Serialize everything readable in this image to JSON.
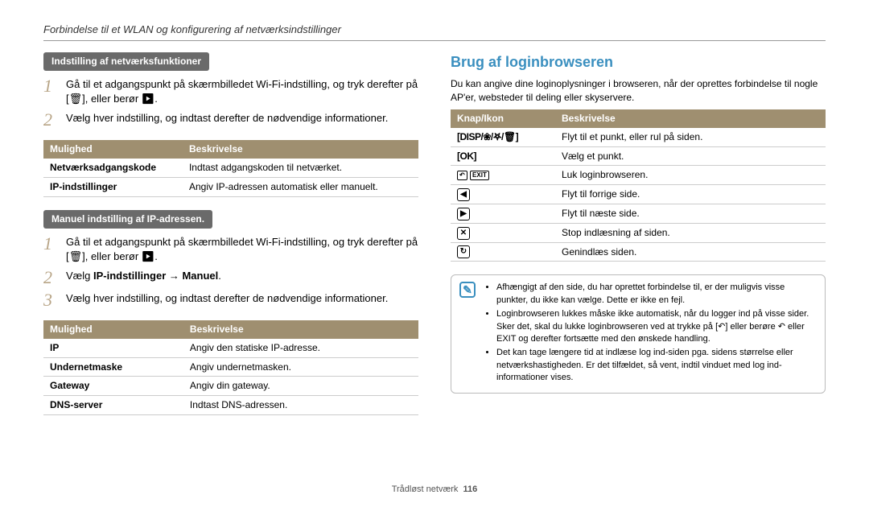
{
  "header": "Forbindelse til et WLAN og konfigurering af netværksindstillinger",
  "left": {
    "sub1": "Indstilling af netværksfunktioner",
    "steps1": [
      "Gå til et adgangspunkt på skærmbilledet Wi-Fi-indstilling, og tryk derefter på [🗑], eller berør ▶.",
      "Vælg hver indstilling, og indtast derefter de nødvendige informationer."
    ],
    "table1": {
      "h1": "Mulighed",
      "h2": "Beskrivelse",
      "rows": [
        {
          "o": "Netværksadgangskode",
          "d": "Indtast adgangskoden til netværket."
        },
        {
          "o": "IP-indstillinger",
          "d": "Angiv IP-adressen automatisk eller manuelt."
        }
      ]
    },
    "sub2": "Manuel indstilling af IP-adressen.",
    "steps2": [
      {
        "plain": "Gå til et adgangspunkt på skærmbilledet Wi-Fi-indstilling, og tryk derefter på [🗑], eller berør ▶."
      },
      {
        "pre": "Vælg ",
        "bold": "IP-indstillinger → Manuel",
        "post": "."
      },
      {
        "plain": "Vælg hver indstilling, og indtast derefter de nødvendige informationer."
      }
    ],
    "table2": {
      "h1": "Mulighed",
      "h2": "Beskrivelse",
      "rows": [
        {
          "o": "IP",
          "d": "Angiv den statiske IP-adresse."
        },
        {
          "o": "Undernetmaske",
          "d": "Angiv undernetmasken."
        },
        {
          "o": "Gateway",
          "d": "Angiv din gateway."
        },
        {
          "o": "DNS-server",
          "d": "Indtast DNS-adressen."
        }
      ]
    }
  },
  "right": {
    "title": "Brug af loginbrowseren",
    "intro": "Du kan angive dine loginoplysninger i browseren, når der oprettes forbindelse til nogle AP'er, websteder til deling eller skyservere.",
    "table": {
      "h1": "Knap/Ikon",
      "h2": "Beskrivelse",
      "rows": [
        {
          "icon": "disp",
          "d": "Flyt til et punkt, eller rul på siden."
        },
        {
          "icon": "ok",
          "d": "Vælg et punkt."
        },
        {
          "icon": "exit",
          "d": "Luk loginbrowseren."
        },
        {
          "icon": "left",
          "d": "Flyt til forrige side."
        },
        {
          "icon": "right",
          "d": "Flyt til næste side."
        },
        {
          "icon": "x",
          "d": "Stop indlæsning af siden."
        },
        {
          "icon": "reload",
          "d": "Genindlæs siden."
        }
      ]
    },
    "notes": [
      "Afhængigt af den side, du har oprettet forbindelse til, er der muligvis visse punkter, du ikke kan vælge. Dette er ikke en fejl.",
      "Loginbrowseren lukkes måske ikke automatisk, når du logger ind på visse sider. Sker det, skal du lukke loginbrowseren ved at trykke på [↶] eller berøre ↶ eller EXIT og derefter fortsætte med den ønskede handling.",
      "Det kan tage længere tid at indlæse log ind-siden pga. sidens størrelse eller netværkshastigheden. Er det tilfældet, så vent, indtil vinduet med log ind-informationer vises."
    ]
  },
  "footer": {
    "section": "Trådløst netværk",
    "page": "116"
  }
}
